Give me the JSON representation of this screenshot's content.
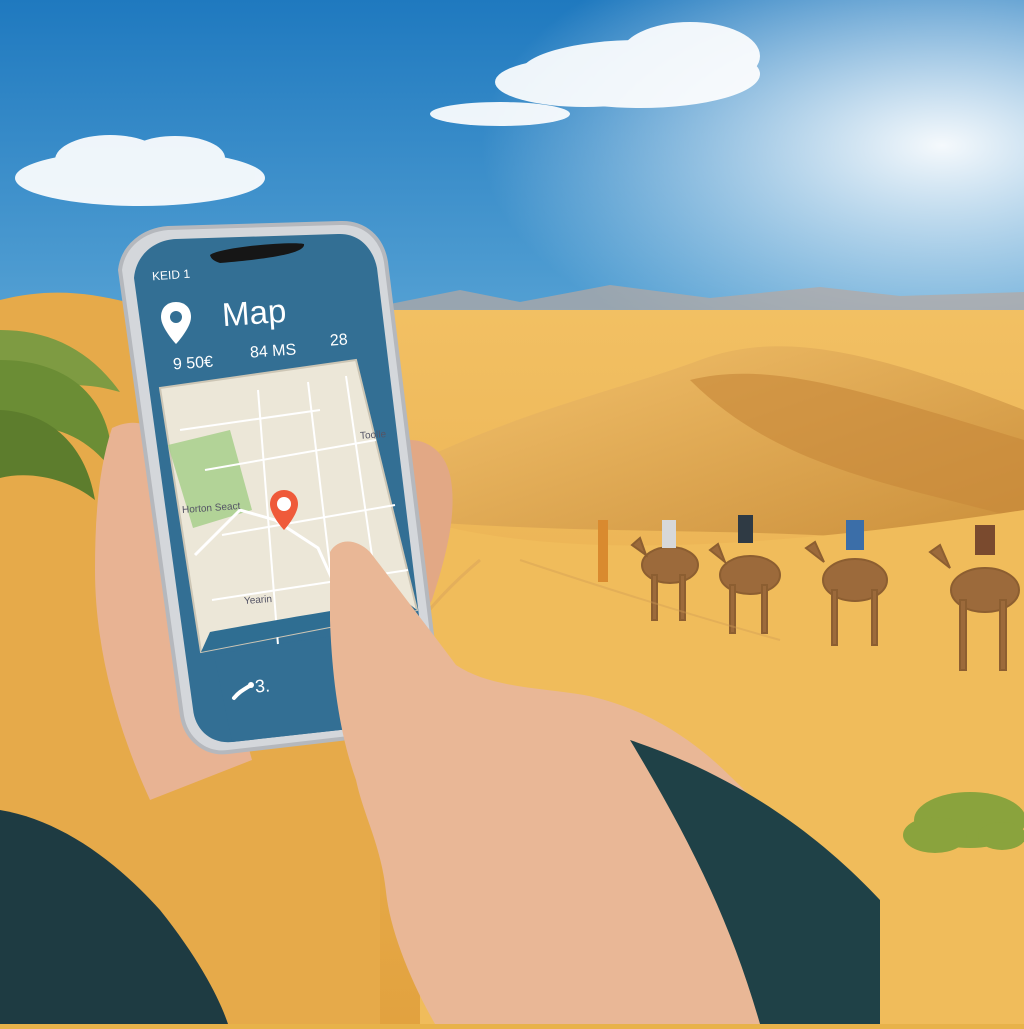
{
  "phone": {
    "status_text": "KEID 1",
    "app_title": "Map",
    "stats": [
      "9 50€",
      "84 MS",
      "28"
    ],
    "map_labels": [
      "Horton Seact",
      "Toolle",
      "Yearin"
    ],
    "bottom_label": "3."
  },
  "icons": [
    "location-pin-icon",
    "map-marker-icon",
    "route-icon"
  ],
  "colors": {
    "sky_top": "#2a86c8",
    "sky_bottom": "#bcdff2",
    "sand": "#e9b34b",
    "phone_panel": "#336f94",
    "map_pin": "#ef5a3a"
  }
}
